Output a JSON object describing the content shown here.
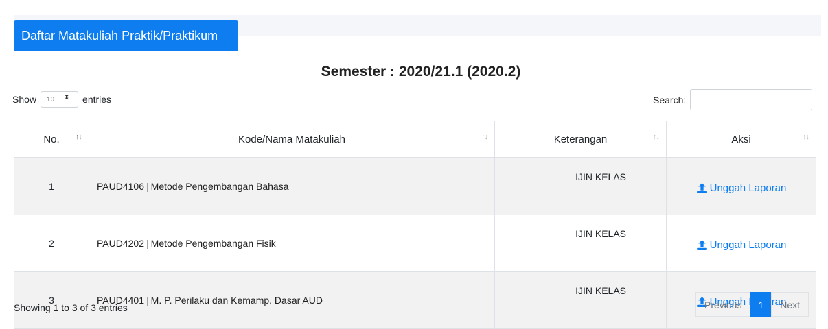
{
  "tab": {
    "label": "Daftar Matakuliah Praktik/Praktikum"
  },
  "semester_title": "Semester : 2020/21.1 (2020.2)",
  "length_menu": {
    "show": "Show",
    "selected": "10",
    "entries": "entries"
  },
  "search": {
    "label": "Search:",
    "value": ""
  },
  "table": {
    "headers": [
      "No.",
      "Kode/Nama Matakuliah",
      "Keterangan",
      "Aksi"
    ],
    "rows": [
      {
        "no": "1",
        "kode": "PAUD4106",
        "nama": "Metode Pengembangan Bahasa",
        "ket": "IJIN KELAS",
        "aksi": "Unggah Laporan"
      },
      {
        "no": "2",
        "kode": "PAUD4202",
        "nama": "Metode Pengembangan Fisik",
        "ket": "IJIN KELAS",
        "aksi": "Unggah Laporan"
      },
      {
        "no": "3",
        "kode": "PAUD4401",
        "nama": "M. P. Perilaku dan Kemamp. Dasar AUD",
        "ket": "IJIN KELAS",
        "aksi": "Unggah Laporan"
      }
    ]
  },
  "info": "Showing 1 to 3 of 3 entries",
  "pagination": {
    "previous": "Previous",
    "current": "1",
    "next": "Next"
  },
  "colors": {
    "accent": "#0d7df0",
    "stripe": "#f2f2f2"
  },
  "icons": {
    "sort": "sort-icon",
    "upload": "upload-icon",
    "select": "select-arrows-icon"
  }
}
